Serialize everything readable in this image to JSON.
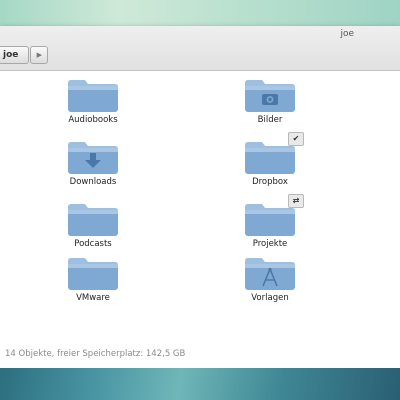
{
  "window": {
    "title": "joe"
  },
  "pathbar": {
    "current": "joe"
  },
  "files": [
    {
      "label": "Audiobooks",
      "icon": "folder-icon",
      "emblem": ""
    },
    {
      "label": "Bilder",
      "icon": "pictures-folder-icon",
      "emblem": ""
    },
    {
      "label": "Downloads",
      "icon": "downloads-folder-icon",
      "emblem": ""
    },
    {
      "label": "Dropbox",
      "icon": "folder-icon",
      "emblem": "✔"
    },
    {
      "label": "Podcasts",
      "icon": "folder-icon",
      "emblem": ""
    },
    {
      "label": "Projekte",
      "icon": "folder-icon",
      "emblem": "⇄"
    },
    {
      "label": "VMware",
      "icon": "folder-icon",
      "emblem": ""
    },
    {
      "label": "Vorlagen",
      "icon": "templates-folder-icon",
      "emblem": ""
    }
  ],
  "status": {
    "text": "14 Objekte, freier Speicherplatz: 142,5 GB"
  },
  "colors": {
    "folder": "#7fa9d2",
    "folder_tab": "#a9c7e5",
    "accent": "#4a78a8"
  }
}
